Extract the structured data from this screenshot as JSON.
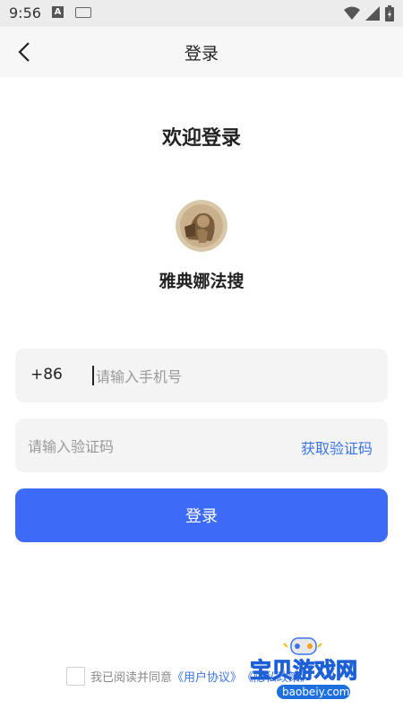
{
  "status": {
    "time": "9:56",
    "a_badge": "A"
  },
  "appbar": {
    "title": "登录"
  },
  "welcome": "欢迎登录",
  "app": {
    "name": "雅典娜法搜"
  },
  "phone": {
    "prefix": "+86",
    "placeholder": "请输入手机号",
    "value": ""
  },
  "code": {
    "placeholder": "请输入验证码",
    "value": "",
    "get_code": "获取验证码"
  },
  "login_button": "登录",
  "agreement": {
    "text": "我已阅读并同意",
    "user_agreement": "《用户协议》",
    "privacy_policy": "《隐私政策》"
  },
  "watermark": {
    "title": "宝贝游戏网",
    "url": "baobeiy.com"
  },
  "colors": {
    "primary": "#3d6bf7",
    "link": "#3a74e8",
    "field_bg": "#f4f4f4"
  }
}
